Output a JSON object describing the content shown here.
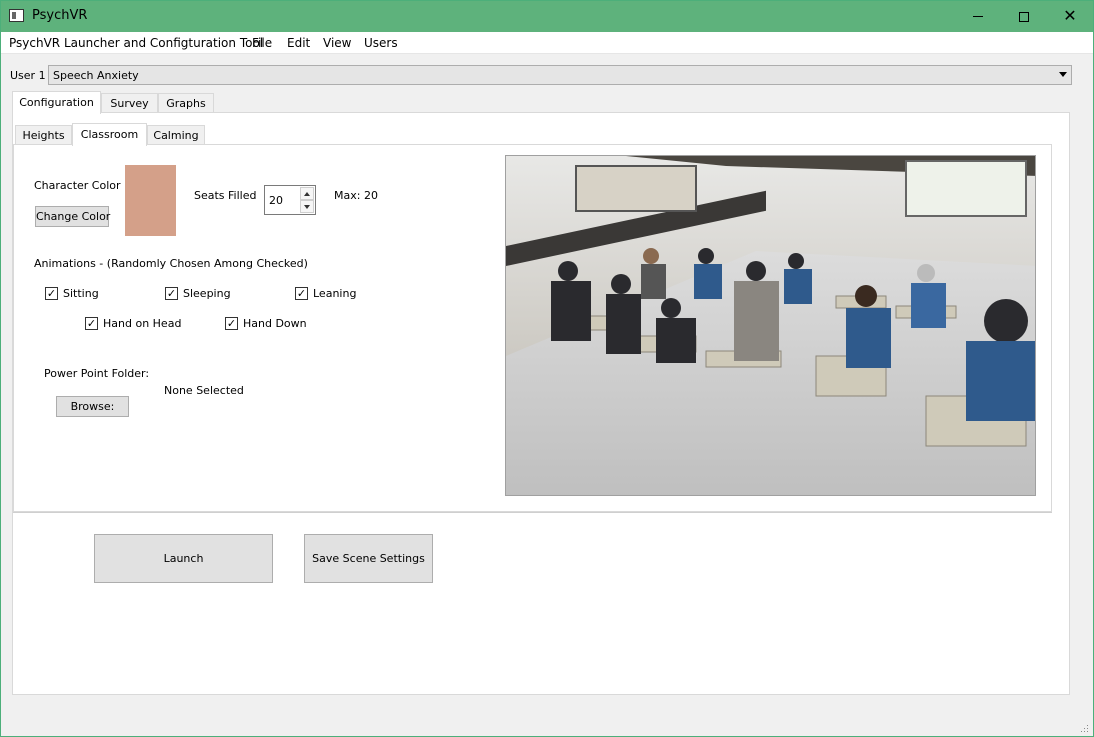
{
  "window": {
    "title": "PsychVR",
    "minimize_label": "",
    "close_label": "✕"
  },
  "menu": {
    "app_label": "PsychVR Launcher and Configturation Tool",
    "file": "File",
    "edit": "Edit",
    "view": "View",
    "users": "Users"
  },
  "user": {
    "label": "User 1",
    "selected": "Speech Anxiety"
  },
  "outer_tabs": [
    "Configuration",
    "Survey",
    "Graphs"
  ],
  "inner_tabs": [
    "Heights",
    "Classroom",
    "Calming"
  ],
  "classroom": {
    "character_color_label": "Character Color",
    "character_color": "#d4a089",
    "change_color_button": "Change Color",
    "seats_label": "Seats Filled",
    "seats_value": "20",
    "max_label": "Max: 20",
    "animations_label": "Animations - (Randomly Chosen Among Checked)",
    "animations": [
      {
        "label": "Sitting",
        "checked": true
      },
      {
        "label": "Sleeping",
        "checked": true
      },
      {
        "label": "Leaning",
        "checked": true
      },
      {
        "label": "Hand on Head",
        "checked": true
      },
      {
        "label": "Hand Down",
        "checked": true
      }
    ],
    "ppt_label": "Power Point Folder:",
    "browse_button": "Browse:",
    "ppt_value": "None Selected"
  },
  "actions": {
    "launch": "Launch",
    "save": "Save Scene Settings"
  }
}
